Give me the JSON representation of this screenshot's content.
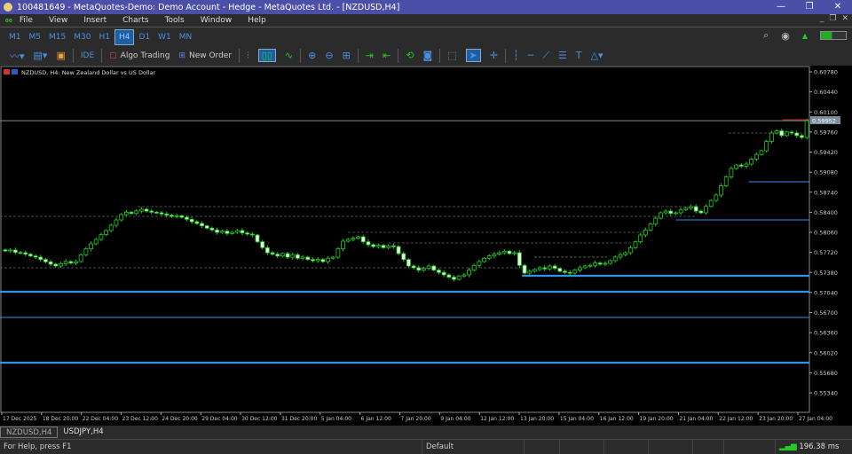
{
  "window": {
    "title": "100481649 - MetaQuotes-Demo: Demo Account - Hedge - MetaQuotes Ltd. - [NZDUSD,H4]",
    "minimize": "—",
    "restore": "❐",
    "close": "✕"
  },
  "menu": [
    "File",
    "View",
    "Insert",
    "Charts",
    "Tools",
    "Window",
    "Help"
  ],
  "timeframes": [
    "M1",
    "M5",
    "M15",
    "M30",
    "H1",
    "H4",
    "D1",
    "W1",
    "MN"
  ],
  "active_timeframe": "H4",
  "toolbar": {
    "ide": "IDE",
    "algo_trading": "Algo Trading",
    "new_order": "New Order"
  },
  "chart": {
    "label": "NZDUSD, H4:  New Zealand Dollar vs US Dollar",
    "current_price": "0.59952",
    "price_ticks": [
      "0.60780",
      "0.60440",
      "0.60100",
      "0.59760",
      "0.59420",
      "0.59080",
      "0.58740",
      "0.58400",
      "0.58060",
      "0.57720",
      "0.57380",
      "0.57040",
      "0.56700",
      "0.56360",
      "0.56020",
      "0.55680",
      "0.55340"
    ],
    "time_ticks": [
      "17 Dec 2025",
      "18 Dec 20:00",
      "22 Dec 04:00",
      "23 Dec 12:00",
      "24 Dec 20:00",
      "29 Dec 04:00",
      "30 Dec 12:00",
      "31 Dec 20:00",
      "5 Jan 04:00",
      "6 Jan 12:00",
      "7 Jan 20:00",
      "9 Jan 04:00",
      "12 Jan 12:00",
      "13 Jan 20:00",
      "15 Jan 04:00",
      "16 Jan 12:00",
      "19 Jan 20:00",
      "21 Jan 04:00",
      "22 Jan 12:00",
      "23 Jan 20:00",
      "27 Jan 04:00"
    ],
    "colors": {
      "bull": "#22cc22",
      "bear": "#e8f8e0",
      "level": "#3a8ee8",
      "grid_dash": "#666666",
      "price_line": "#888888"
    },
    "closes": [
      0.57744,
      0.5776,
      0.5772,
      0.57714,
      0.5769,
      0.5766,
      0.57639,
      0.576,
      0.5756,
      0.5752,
      0.57489,
      0.5753,
      0.57564,
      0.5754,
      0.57564,
      0.5768,
      0.5778,
      0.57865,
      0.5794,
      0.5802,
      0.5809,
      0.5818,
      0.5827,
      0.58361,
      0.584,
      0.5838,
      0.58421,
      0.58451,
      0.5842,
      0.584,
      0.58391,
      0.5837,
      0.5835,
      0.5833,
      0.5834,
      0.58315,
      0.5828,
      0.5824,
      0.5821,
      0.5817,
      0.5813,
      0.581,
      0.5806,
      0.5808,
      0.5804,
      0.5806,
      0.5809,
      0.5805,
      0.5803,
      0.58015,
      0.579,
      0.578,
      0.57714,
      0.5769,
      0.5766,
      0.577,
      0.57639,
      0.5768,
      0.5762,
      0.57639,
      0.576,
      0.5758,
      0.576,
      0.57564,
      0.5762,
      0.57639,
      0.5778,
      0.5791,
      0.5794,
      0.5796,
      0.57985,
      0.579,
      0.5785,
      0.57819,
      0.5784,
      0.578,
      0.5783,
      0.57819,
      0.577,
      0.576,
      0.57489,
      0.5746,
      0.5742,
      0.5745,
      0.57489,
      0.5742,
      0.5738,
      0.57339,
      0.573,
      0.57263,
      0.5732,
      0.57339,
      0.5742,
      0.575,
      0.57564,
      0.5762,
      0.5766,
      0.5769,
      0.57714,
      0.5774,
      0.577,
      0.57714,
      0.575,
      0.57369,
      0.574,
      0.5743,
      0.57459,
      0.5744,
      0.57489,
      0.5745,
      0.574,
      0.5738,
      0.57369,
      0.5742,
      0.5746,
      0.57489,
      0.575,
      0.5754,
      0.5752,
      0.57534,
      0.5758,
      0.5764,
      0.5768,
      0.57714,
      0.578,
      0.579,
      0.58015,
      0.581,
      0.582,
      0.583,
      0.58391,
      0.5842,
      0.5838,
      0.58391,
      0.5844,
      0.5847,
      0.58496,
      0.5842,
      0.58391,
      0.585,
      0.586,
      0.58691,
      0.5885,
      0.59,
      0.59142,
      0.592,
      0.5918,
      0.59217,
      0.593,
      0.5938,
      0.59443,
      0.596,
      0.59743,
      0.5978,
      0.597,
      0.5976,
      0.59743,
      0.597,
      0.59668,
      0.59952
    ],
    "levels": [
      {
        "price": 0.58917,
        "from": 0.925,
        "thick": false
      },
      {
        "price": 0.5827,
        "from": 0.835,
        "thick": false
      },
      {
        "price": 0.57324,
        "from": 0.645,
        "thick": true
      },
      {
        "price": 0.57053,
        "from": 0,
        "thick": true
      },
      {
        "price": 0.56617,
        "from": 0,
        "thick": false
      },
      {
        "price": 0.55851,
        "from": 0,
        "thick": true
      }
    ],
    "dashed_levels": [
      {
        "price": 0.5833,
        "from": 0,
        "to": 0.86
      },
      {
        "price": 0.58496,
        "from": 0.17,
        "to": 0.86
      },
      {
        "price": 0.5806,
        "from": 0.43,
        "to": 0.8
      },
      {
        "price": 0.5788,
        "from": 0.48,
        "to": 0.78
      },
      {
        "price": 0.57459,
        "from": 0,
        "to": 0.65
      },
      {
        "price": 0.5764,
        "from": 0.66,
        "to": 0.75
      },
      {
        "price": 0.59743,
        "from": 0.9,
        "to": 1
      }
    ]
  },
  "tabs": [
    "NZDUSD,H4",
    "USDJPY,H4"
  ],
  "status": {
    "help": "For Help, press F1",
    "profile": "Default",
    "ping": "196.38 ms"
  }
}
